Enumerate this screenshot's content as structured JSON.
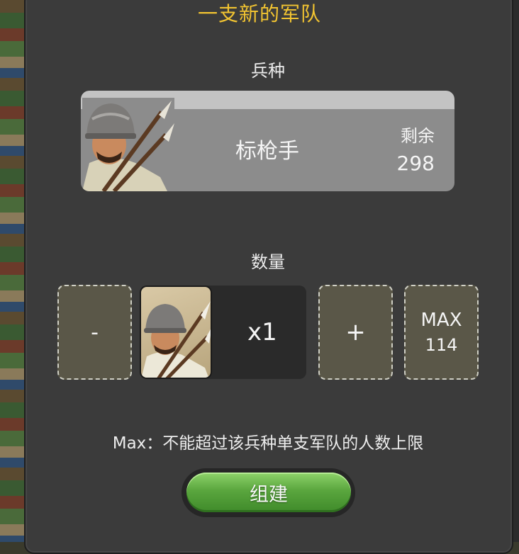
{
  "dialog": {
    "title": "一支新的军队",
    "unit_type_label": "兵种",
    "unit": {
      "name": "标枪手",
      "remaining_label": "剩余",
      "remaining_value": "298"
    },
    "quantity_label": "数量",
    "controls": {
      "minus_label": "-",
      "quantity_value": "x1",
      "plus_label": "+",
      "max_label": "MAX",
      "max_value": "114"
    },
    "note": "Max：不能超过该兵种单支军队的人数上限",
    "build_label": "组建"
  },
  "colors": {
    "title": "#f2c431",
    "dialog_bg": "#3b3b3b",
    "button_bg": "#5a5748",
    "build_green": "#5aa63e"
  }
}
